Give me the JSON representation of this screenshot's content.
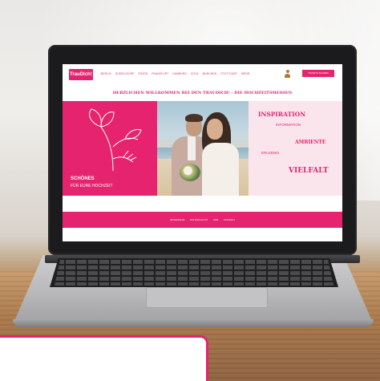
{
  "site": {
    "logo_text": "TrauDich!",
    "nav": [
      "BERLIN",
      "DÜSSELDORF",
      "ESSEN",
      "FRANKFURT",
      "HAMBURG",
      "KÖLN",
      "MÜNCHEN",
      "STUTTGART",
      "MEHR"
    ],
    "cta_label": "TICKETS KAUFEN",
    "welcome": "HERZLICHEN WILLKOMMEN BEI DEN TRAUDICH! - DIE HOCHZEITSMESSEN",
    "left_title": "SCHÖNES",
    "left_sub": "FÜR EURE HOCHZEIT",
    "right_words": [
      "INSPIRATION",
      "INFORMATION",
      "AMBIENTE",
      "ERLEBNIS",
      "VIELFALT"
    ],
    "footer_links": [
      "IMPRESSUM",
      "DATENSCHUTZ",
      "AGB",
      "KONTAKT"
    ]
  },
  "colors": {
    "brand": "#e6236e",
    "panel_light": "#fbe5ec"
  },
  "icons": {
    "user": "user-icon"
  }
}
